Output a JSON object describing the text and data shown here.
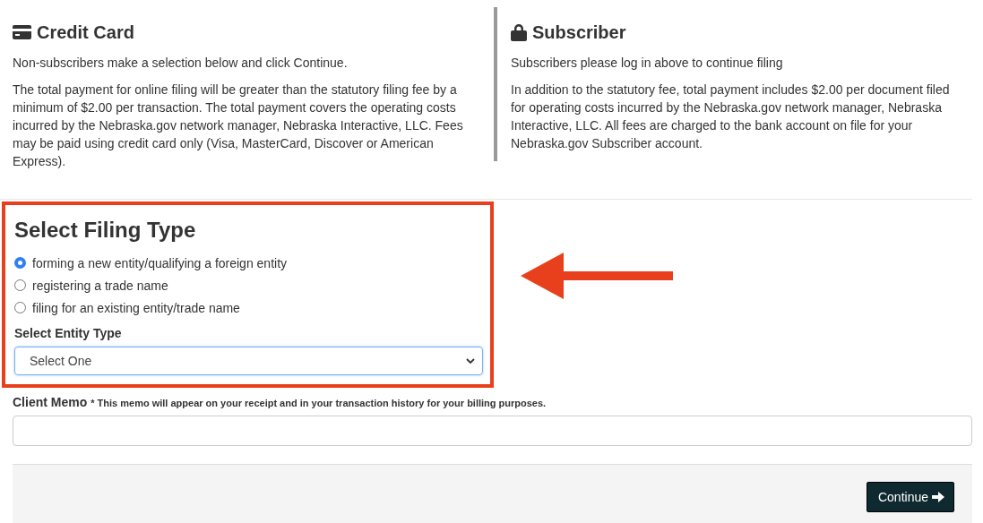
{
  "payment_options": [
    {
      "kind": "card",
      "title": "Credit Card",
      "intro": "Non-subscribers make a selection below and click Continue.",
      "details": "The total payment for online filing will be greater than the statutory filing fee by a minimum of $2.00 per transaction. The total payment covers the operating costs incurred by the Nebraska.gov network manager, Nebraska Interactive, LLC. Fees may be paid using credit card only (Visa, MasterCard, Discover or American Express)."
    },
    {
      "kind": "lock",
      "title": "Subscriber",
      "intro": "Subscribers please log in above to continue filing",
      "details": "In addition to the statutory fee, total payment includes $2.00 per document filed for operating costs incurred by the Nebraska.gov network manager, Nebraska Interactive, LLC. All fees are charged to the bank account on file for your Nebraska.gov Subscriber account."
    }
  ],
  "filing_type": {
    "title": "Select Filing Type",
    "options": [
      {
        "label": "forming a new entity/qualifying a foreign entity",
        "selected": true
      },
      {
        "label": "registering a trade name",
        "selected": false
      },
      {
        "label": "filing for an existing entity/trade name",
        "selected": false
      }
    ],
    "entity_type": {
      "label": "Select Entity Type",
      "value": "Select One"
    }
  },
  "client_memo": {
    "label": "Client Memo",
    "note": "* This memo will appear on your receipt and in your transaction history for your billing purposes."
  },
  "buttons": [
    {
      "label": "Continue"
    }
  ]
}
